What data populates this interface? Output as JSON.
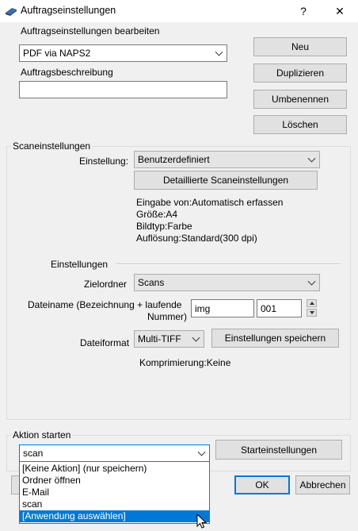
{
  "window": {
    "title": "Auftragseinstellungen",
    "help_label": "?",
    "close_label": "✕"
  },
  "job": {
    "edit_label": "Auftragseinstellungen bearbeiten",
    "selected_job": "PDF via NAPS2",
    "description_label": "Auftragsbeschreibung",
    "description_value": ""
  },
  "side_buttons": {
    "new": "Neu",
    "duplicate": "Duplizieren",
    "rename": "Umbenennen",
    "delete": "Löschen"
  },
  "scan": {
    "group_label": "Scaneinstellungen",
    "setting_label": "Einstellung:",
    "setting_value": "Benutzerdefiniert",
    "detailed_button": "Detaillierte Scaneinstellungen",
    "info": [
      "Eingabe von:Automatisch erfassen",
      "Größe:A4",
      "Bildtyp:Farbe",
      "Auflösung:Standard(300 dpi)"
    ]
  },
  "settings": {
    "section_label": "Einstellungen",
    "target_folder_label": "Zielordner",
    "target_folder_value": "Scans",
    "filename_label_line1": "Dateiname (Bezeichnung + laufende",
    "filename_label_line2": "Nummer)",
    "filename_prefix": "img",
    "filename_number": "001",
    "format_label": "Dateiformat",
    "format_value": "Multi-TIFF",
    "save_settings_button": "Einstellungen speichern",
    "compression_text": "Komprimierung:Keine"
  },
  "action": {
    "group_label": "Aktion starten",
    "selected": "scan",
    "start_settings_button": "Starteinstellungen",
    "options": [
      "[Keine Aktion] (nur speichern)",
      "Ordner öffnen",
      "E-Mail",
      "scan",
      "[Anwendung auswählen]"
    ],
    "highlighted_index": 4
  },
  "footer": {
    "ok": "OK",
    "cancel": "Abbrechen"
  },
  "colors": {
    "accent": "#0078d7",
    "window_bg": "#f0f0f0"
  }
}
